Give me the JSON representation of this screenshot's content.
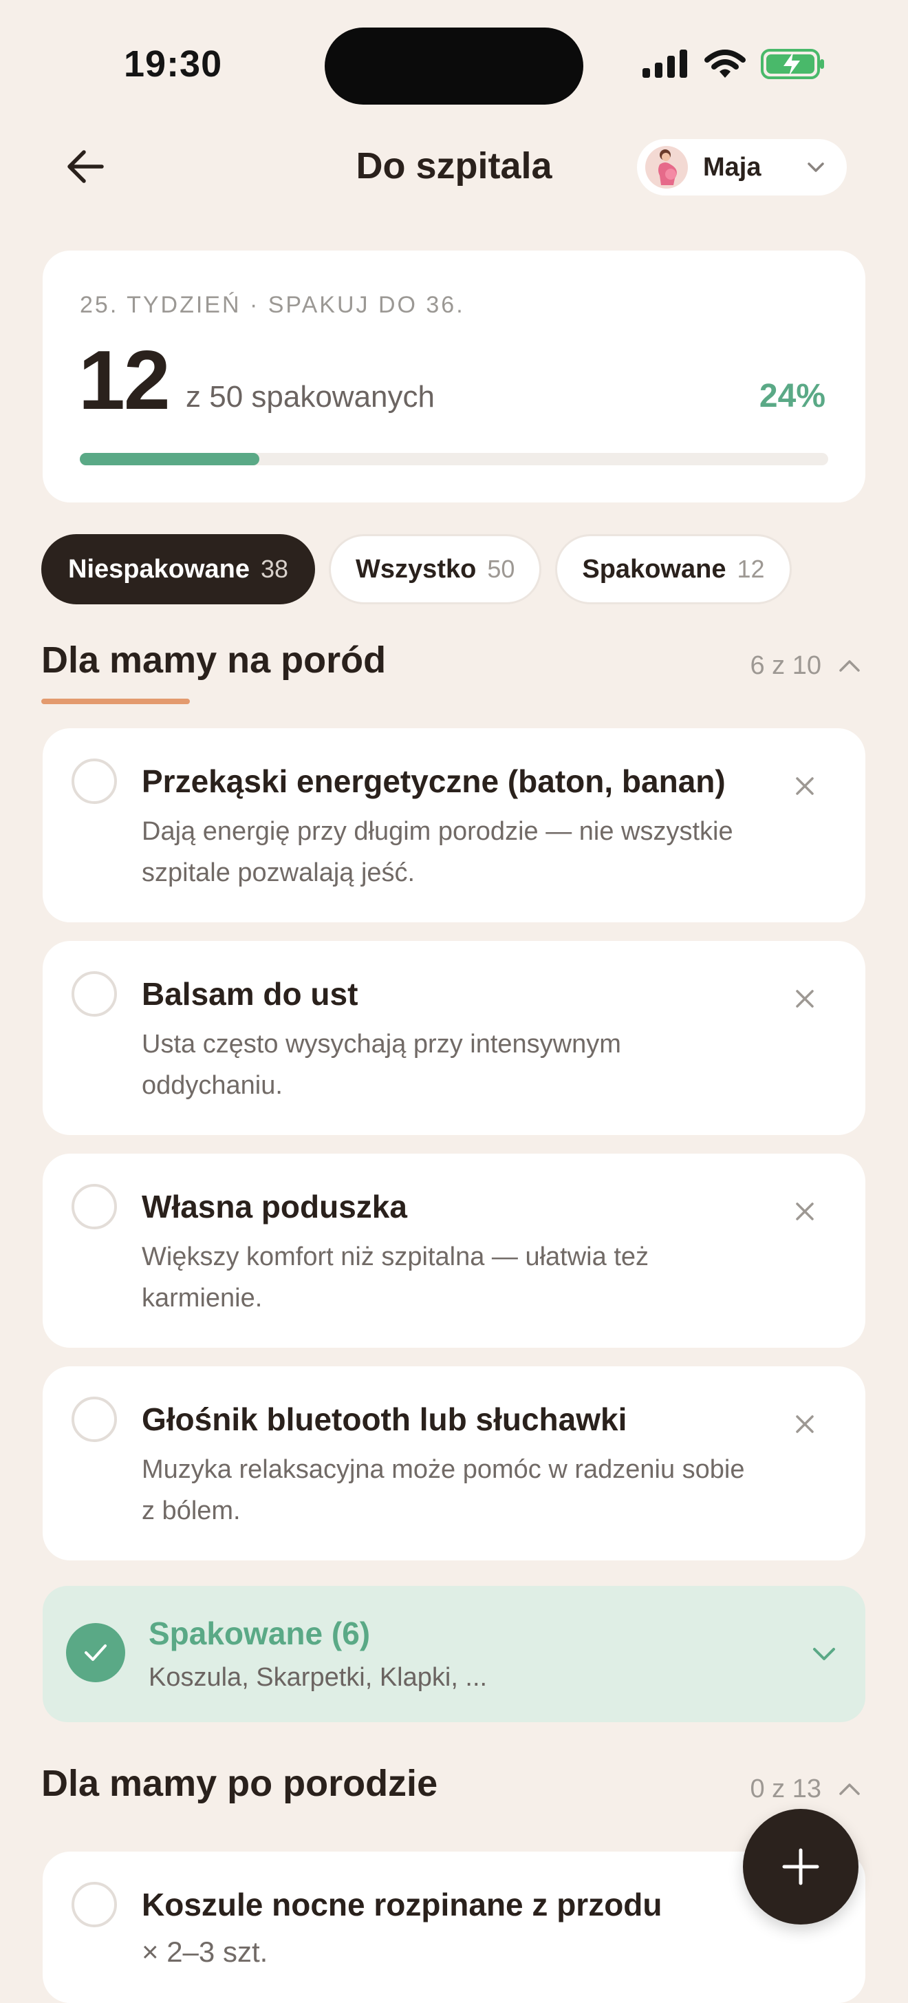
{
  "status_bar": {
    "time": "19:30"
  },
  "header": {
    "title": "Do szpitala",
    "profile_name": "Maja"
  },
  "progress": {
    "week_label": "25. TYDZIEŃ · SPAKUJ DO 36.",
    "packed": "12",
    "total_label": "z 50 spakowanych",
    "percent_label": "24%",
    "percent_value": 0.24
  },
  "filters": [
    {
      "label": "Niespakowane",
      "count": "38",
      "active": true
    },
    {
      "label": "Wszystko",
      "count": "50",
      "active": false
    },
    {
      "label": "Spakowane",
      "count": "12",
      "active": false
    }
  ],
  "section1": {
    "title": "Dla mamy na poród",
    "count": "6 z 10",
    "items": [
      {
        "title": "Przekąski energetyczne (baton, banan)",
        "desc": "Dają energię przy długim porodzie — nie wszystkie szpitale pozwalają jeść."
      },
      {
        "title": "Balsam do ust",
        "desc": "Usta często wysychają przy intensywnym oddychaniu."
      },
      {
        "title": "Własna poduszka",
        "desc": "Większy komfort niż szpitalna — ułatwia też karmienie."
      },
      {
        "title": "Głośnik bluetooth lub słuchawki",
        "desc": "Muzyka relaksacyjna może pomóc w radzeniu sobie z bólem."
      }
    ],
    "packed": {
      "title": "Spakowane (6)",
      "list": "Koszula, Skarpetki, Klapki, ..."
    }
  },
  "section2": {
    "title": "Dla mamy po porodzie",
    "count": "0 z 13",
    "items": [
      {
        "title": "Koszule nocne rozpinane z przodu",
        "qty": "× 2–3 szt."
      }
    ]
  },
  "colors": {
    "accent_green": "#5aa986",
    "dark": "#2b221d",
    "underline": "#e39a6e",
    "background": "#f6efe9"
  },
  "icons": [
    "back-arrow-icon",
    "chevron-down-icon",
    "chevron-up-icon",
    "close-icon",
    "check-icon",
    "plus-icon",
    "signal-icon",
    "wifi-icon",
    "battery-charging-icon",
    "pregnant-avatar-icon"
  ]
}
